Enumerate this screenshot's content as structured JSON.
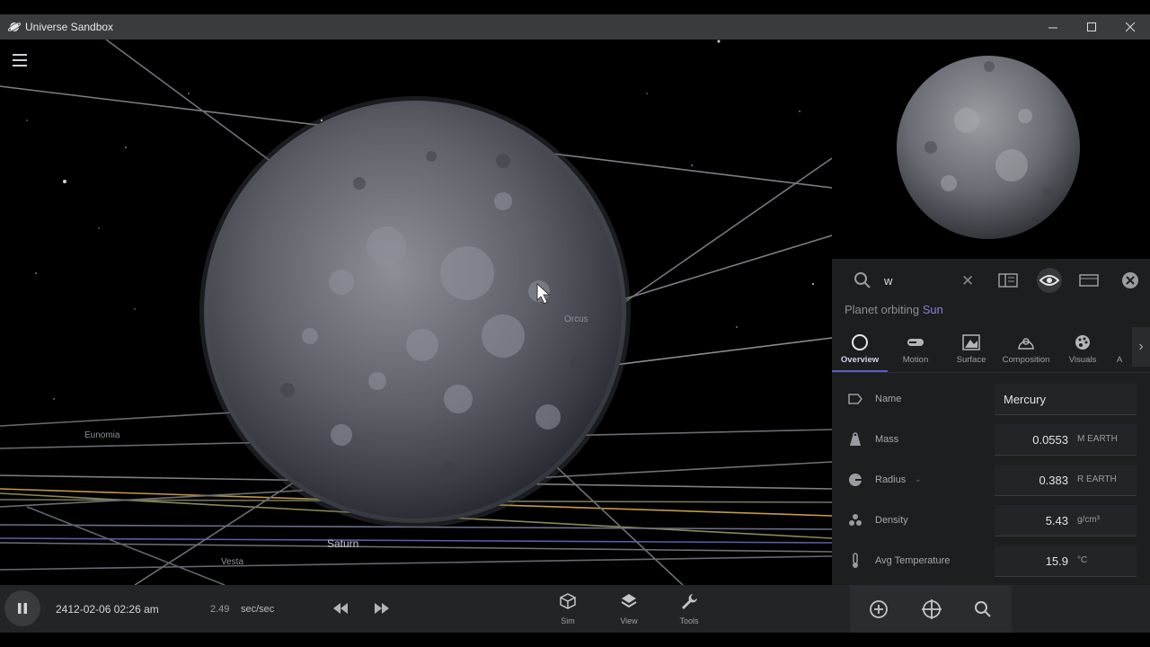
{
  "window": {
    "title": "Universe Sandbox"
  },
  "viewport": {
    "labels": {
      "eunomia": "Eunomia",
      "saturn": "Saturn",
      "vesta": "Vesta",
      "orcus": "Orcus"
    }
  },
  "panel": {
    "search_value": "w",
    "subtitle_prefix": "Planet orbiting",
    "subtitle_link": "Sun",
    "tabs": [
      {
        "label": "Overview",
        "icon": "circle-icon"
      },
      {
        "label": "Motion",
        "icon": "motion-icon"
      },
      {
        "label": "Surface",
        "icon": "surface-icon"
      },
      {
        "label": "Composition",
        "icon": "composition-icon"
      },
      {
        "label": "Visuals",
        "icon": "palette-icon"
      },
      {
        "label": "A",
        "icon": "more-icon"
      }
    ],
    "properties": {
      "name": {
        "label": "Name",
        "value": "Mercury"
      },
      "mass": {
        "label": "Mass",
        "value": "0.0553",
        "unit": "M EARTH"
      },
      "radius": {
        "label": "Radius",
        "value": "0.383",
        "unit": "R EARTH"
      },
      "density": {
        "label": "Density",
        "value": "5.43",
        "unit": "g/cm³"
      },
      "temperature": {
        "label": "Avg Temperature",
        "value": "15.9",
        "unit": "°C"
      }
    }
  },
  "bottombar": {
    "date": "2412-02-06 02:26 am",
    "rate": "2.49",
    "rate_unit": "sec/sec",
    "tools": {
      "sim": "Sim",
      "view": "View",
      "tools": "Tools"
    }
  },
  "colors": {
    "accent": "#5a5ec4",
    "link": "#8a7fd6"
  }
}
